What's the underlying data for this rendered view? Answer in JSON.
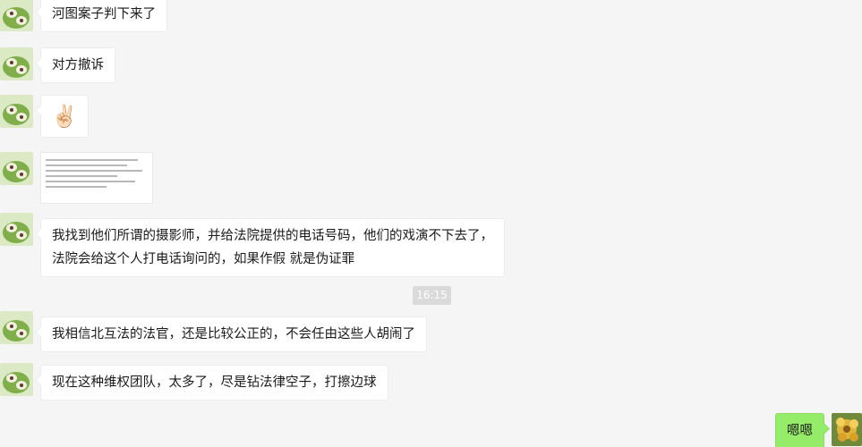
{
  "colors": {
    "background": "#f5f5f5",
    "incoming_bubble": "#ffffff",
    "outgoing_bubble": "#95ec69",
    "timestamp_bg": "#dadada"
  },
  "messages": [
    {
      "sender": "other",
      "type": "text",
      "text": "河图案子判下来了"
    },
    {
      "sender": "other",
      "type": "text",
      "text": "对方撤诉"
    },
    {
      "sender": "other",
      "type": "emoji",
      "text": "✌🏻"
    },
    {
      "sender": "other",
      "type": "image",
      "icon": "document-image-thumbnail"
    },
    {
      "sender": "other",
      "type": "text",
      "lines": [
        "我找到他们所谓的摄影师，并给法院提供的电话号码，他们的戏演不下去了，",
        "法院会给这个人打电话询问的，如果作假 就是伪证罪"
      ]
    },
    {
      "sender": "other",
      "type": "text",
      "text": "我相信北互法的法官，还是比较公正的，不会任由这些人胡闹了"
    },
    {
      "sender": "other",
      "type": "text",
      "text": "现在这种维权团队，太多了，尽是钻法律空子，打擦边球"
    },
    {
      "sender": "self",
      "type": "text",
      "text": "嗯嗯"
    }
  ],
  "timestamp": "16:15",
  "avatars": {
    "other": "green-illustration-avatar",
    "self": "yellow-flower-avatar"
  }
}
